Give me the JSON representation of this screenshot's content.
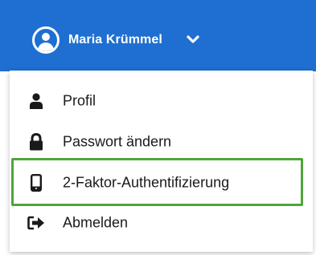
{
  "colors": {
    "topbar_bg": "#1e6fd1",
    "highlight_border": "#4fa53a",
    "text": "#1a1a1a",
    "icon": "#1a1a1a"
  },
  "header": {
    "user_name": "Maria Krümmel",
    "avatar_icon": "user-circle-icon",
    "toggle_icon": "chevron-down-icon"
  },
  "menu": {
    "items": [
      {
        "label": "Profil",
        "icon": "user-icon"
      },
      {
        "label": "Passwort ändern",
        "icon": "lock-icon"
      },
      {
        "label": "2-Faktor-Authentifizierung",
        "icon": "mobile-phone-icon",
        "highlighted": true
      },
      {
        "label": "Abmelden",
        "icon": "sign-out-icon"
      }
    ]
  }
}
